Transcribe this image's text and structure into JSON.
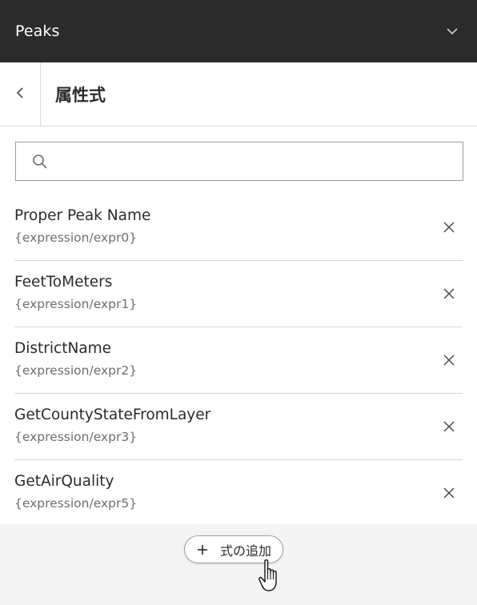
{
  "header": {
    "title": "Peaks",
    "chevron_icon": "chevron-down-icon"
  },
  "subheader": {
    "back_icon": "chevron-left-icon",
    "title": "属性式"
  },
  "search": {
    "placeholder": "",
    "value": "",
    "icon": "search-icon"
  },
  "expressions": [
    {
      "name": "Proper Peak Name",
      "path": "{expression/expr0}"
    },
    {
      "name": "FeetToMeters",
      "path": "{expression/expr1}"
    },
    {
      "name": "DistrictName",
      "path": "{expression/expr2}"
    },
    {
      "name": "GetCountyStateFromLayer",
      "path": "{expression/expr3}"
    },
    {
      "name": "GetAirQuality",
      "path": "{expression/expr5}"
    }
  ],
  "footer": {
    "add_label": "式の追加",
    "add_icon": "plus-icon"
  },
  "colors": {
    "header_bg": "#2b2b2b",
    "header_text": "#ffffff",
    "text": "#2b2b2b",
    "muted_text": "#6e6e6e",
    "border": "#d6d6d6",
    "footer_bg": "#f4f4f4"
  }
}
